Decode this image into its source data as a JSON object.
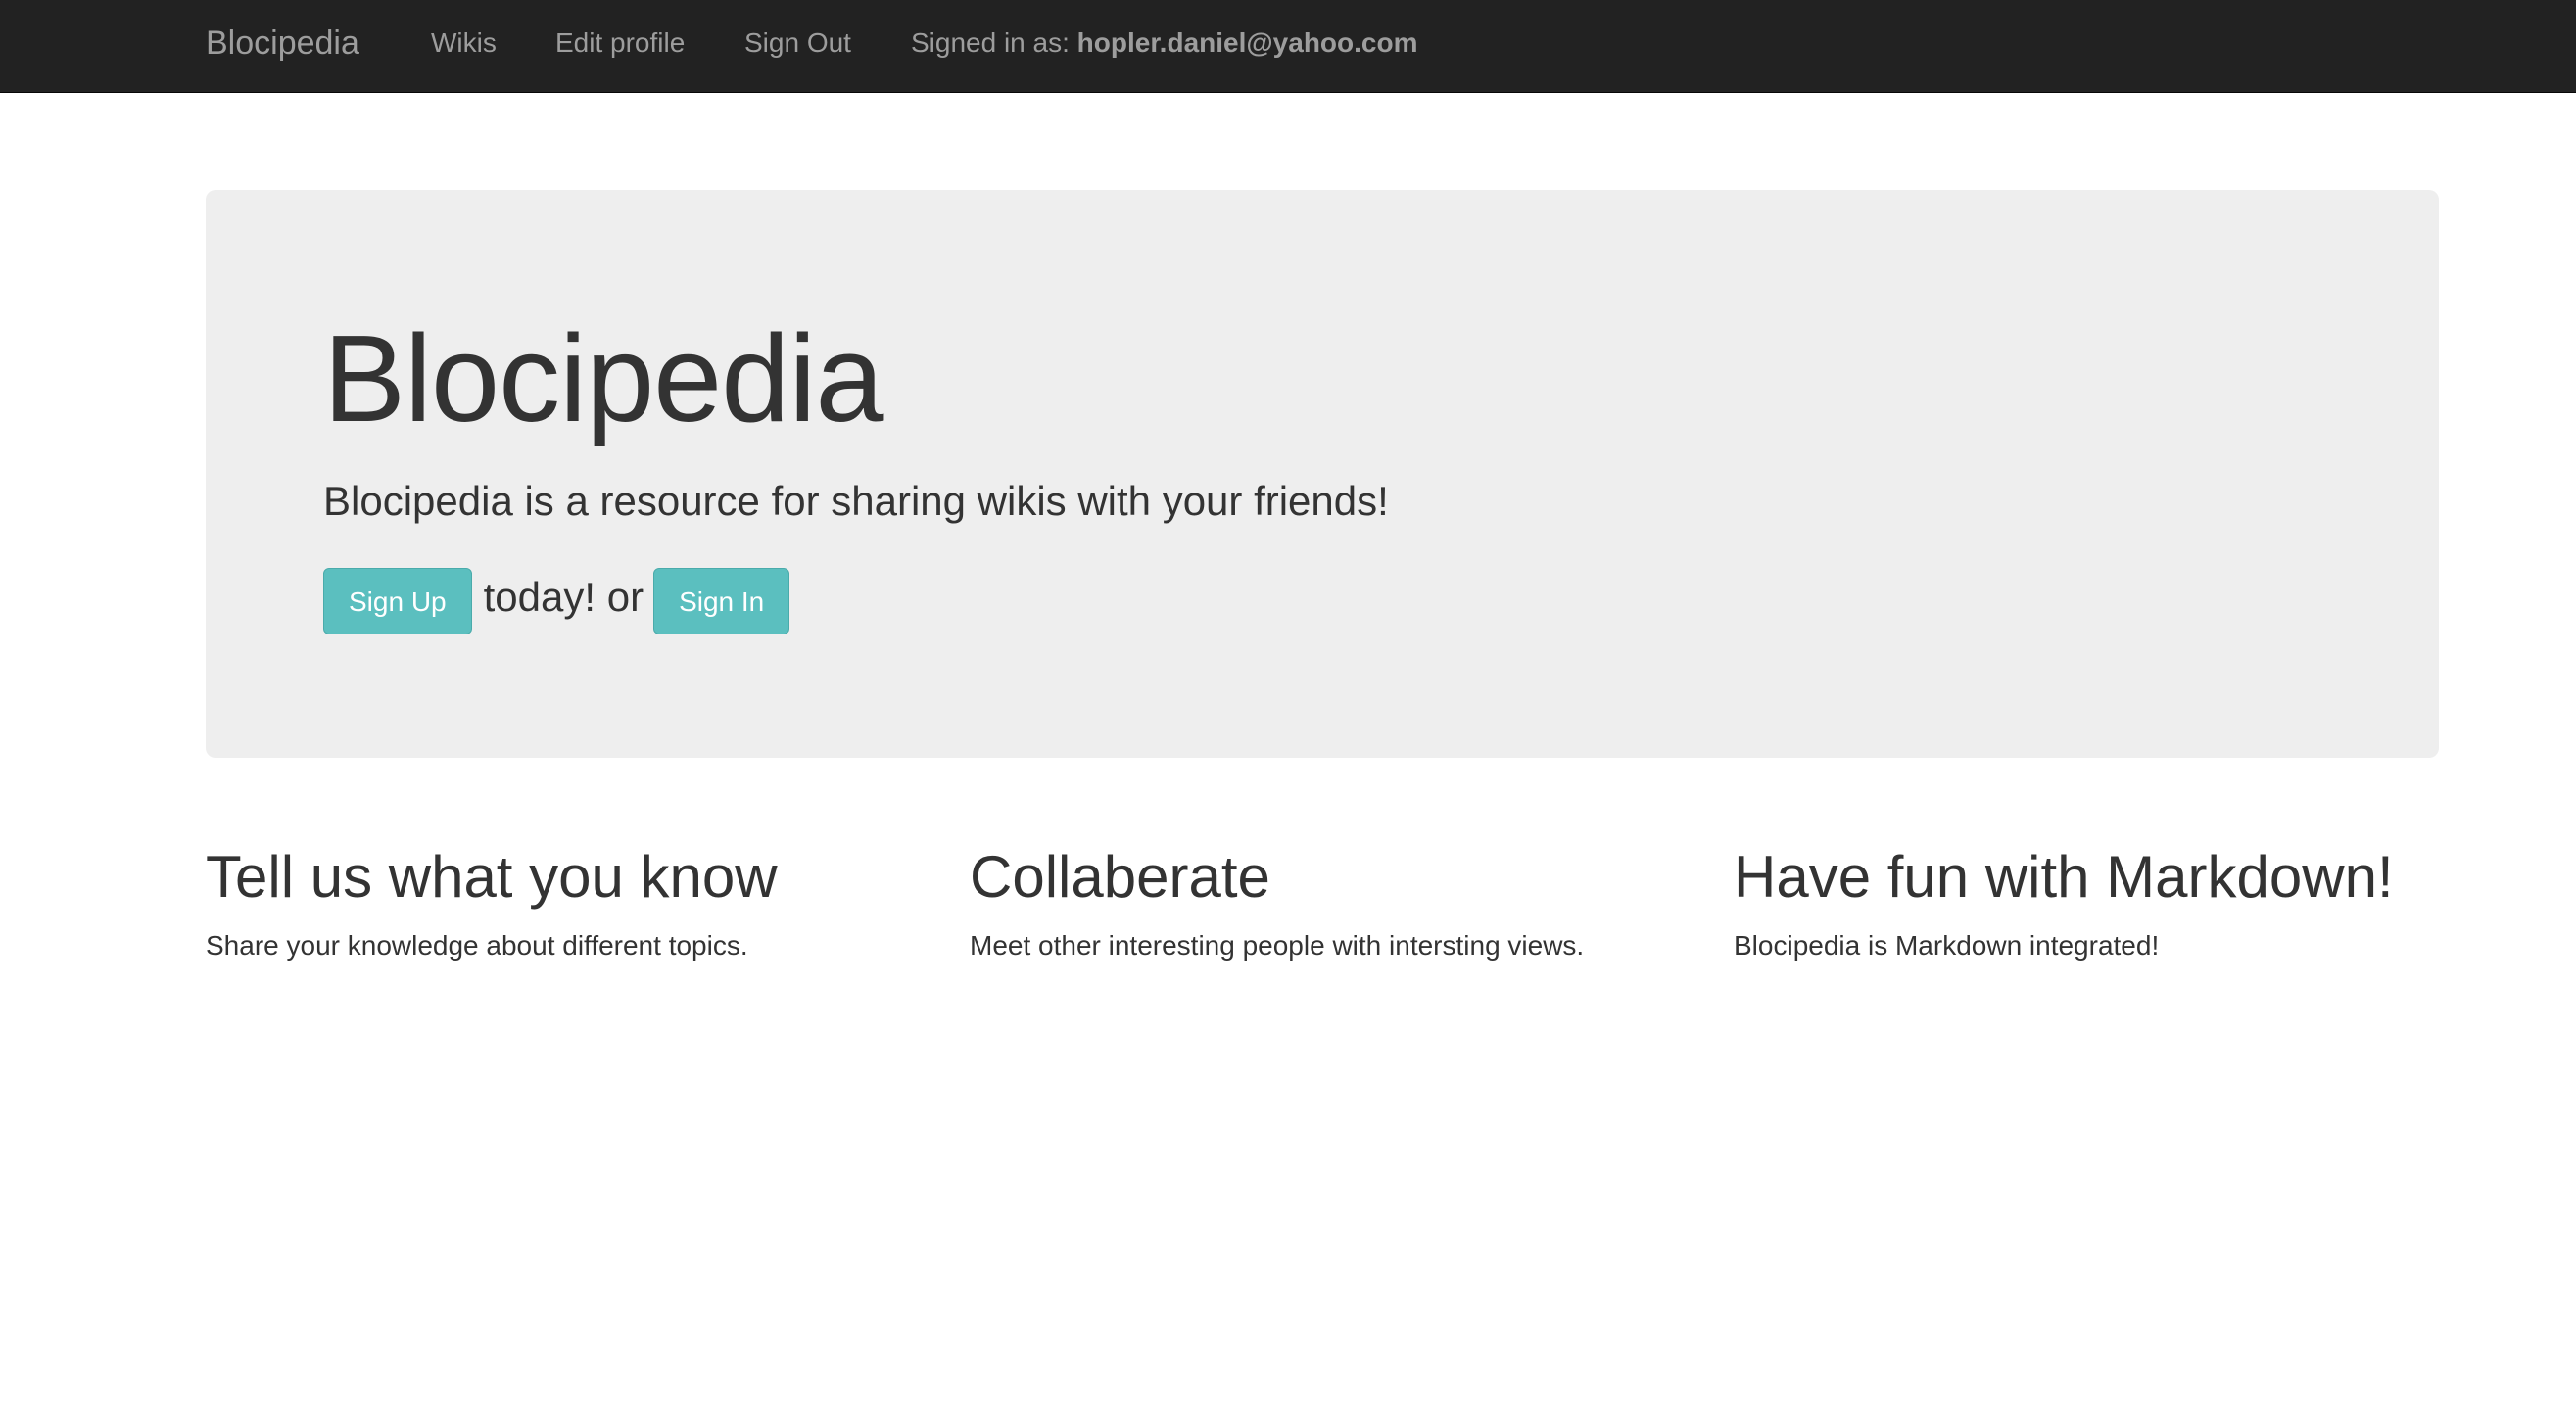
{
  "navbar": {
    "brand": "Blocipedia",
    "links": [
      {
        "label": "Wikis"
      },
      {
        "label": "Edit profile"
      },
      {
        "label": "Sign Out"
      }
    ],
    "signed_in_prefix": "Signed in as: ",
    "signed_in_email": "hopler.daniel@yahoo.com"
  },
  "jumbotron": {
    "title": "Blocipedia",
    "lead": "Blocipedia is a resource for sharing wikis with your friends!",
    "sign_up_label": "Sign Up",
    "middle_text": "today! or",
    "sign_in_label": "Sign In"
  },
  "features": [
    {
      "heading": "Tell us what you know",
      "text": "Share your knowledge about different topics."
    },
    {
      "heading": "Collaberate",
      "text": "Meet other interesting people with intersting views."
    },
    {
      "heading": "Have fun with Markdown!",
      "text": "Blocipedia is Markdown integrated!"
    }
  ],
  "colors": {
    "navbar_bg": "#222222",
    "navbar_text": "#9d9d9d",
    "jumbotron_bg": "#eeeeee",
    "button_bg": "#5bbfbf",
    "button_text": "#ffffff",
    "text": "#333333"
  }
}
